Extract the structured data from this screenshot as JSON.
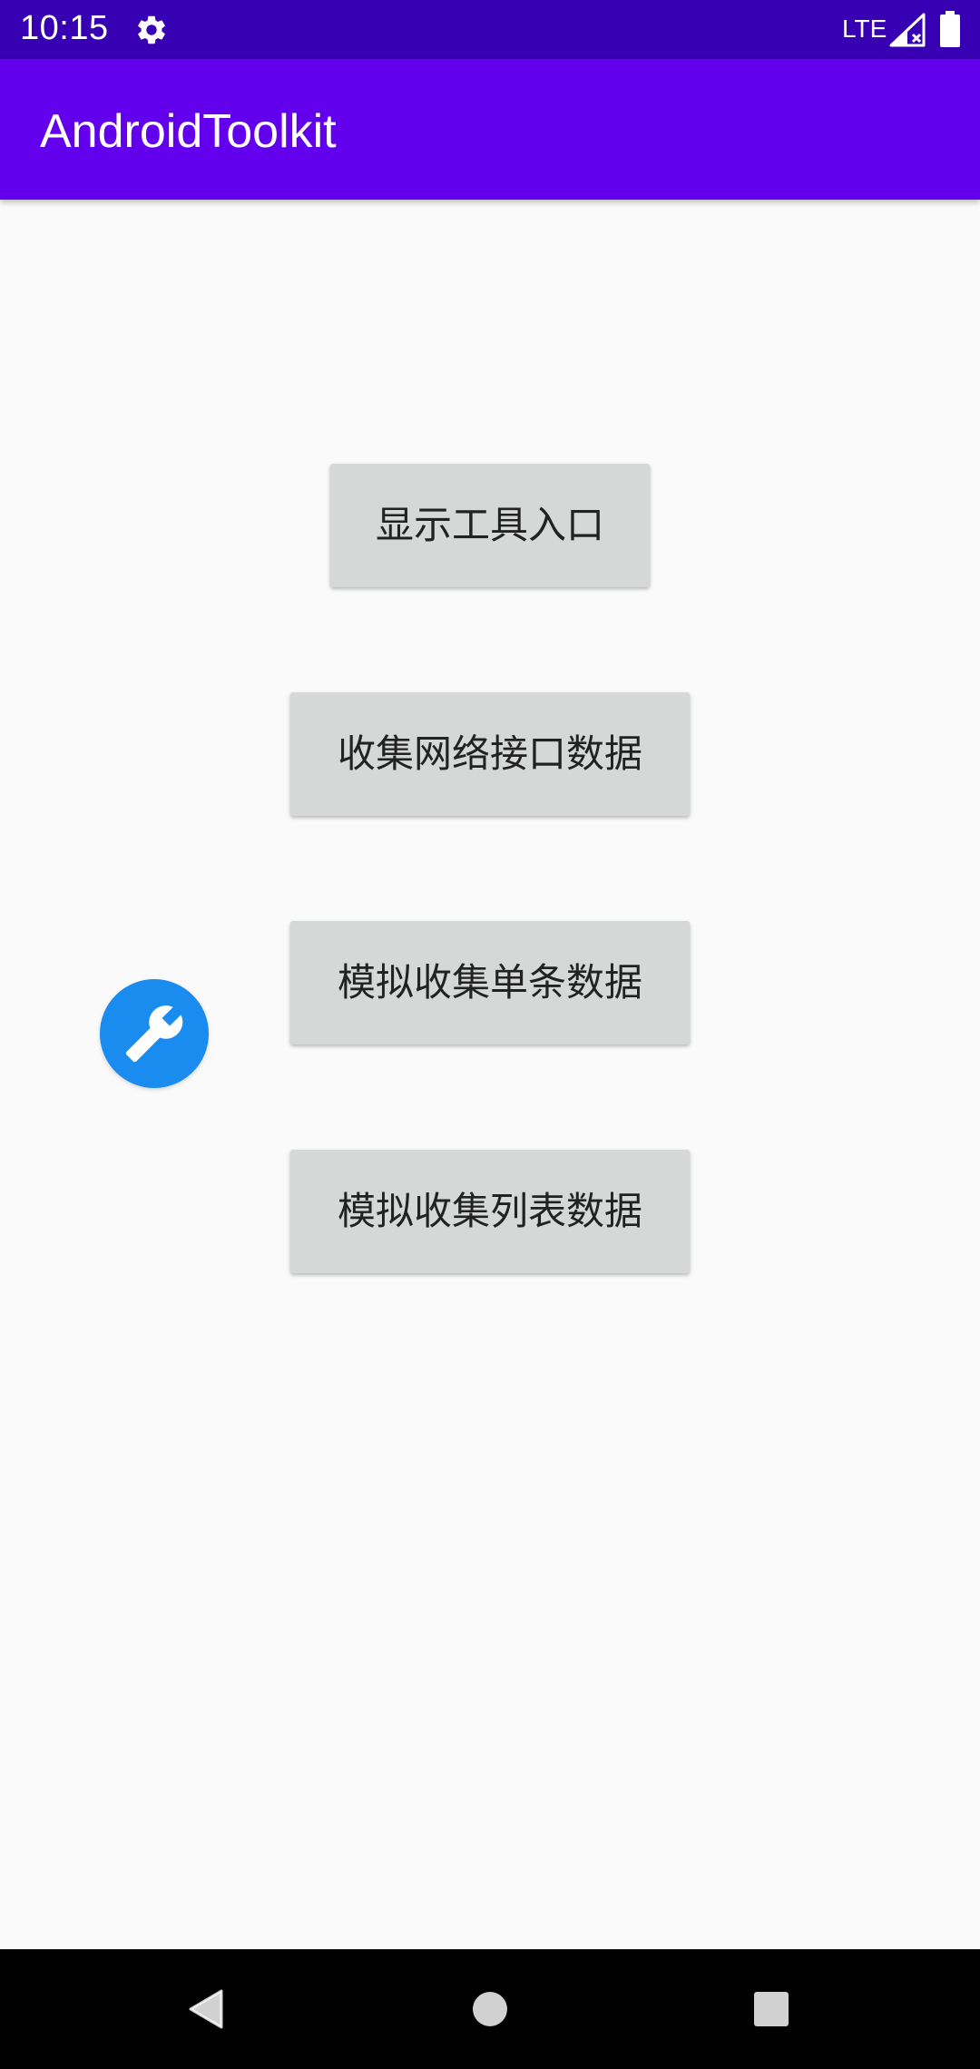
{
  "status_bar": {
    "time": "10:15",
    "network": "LTE",
    "icons": [
      "gear-icon",
      "signal-icon",
      "battery-icon"
    ]
  },
  "app_bar": {
    "title": "AndroidToolkit"
  },
  "buttons": [
    {
      "label": "显示工具入口"
    },
    {
      "label": "收集网络接口数据"
    },
    {
      "label": "模拟收集单条数据"
    },
    {
      "label": "模拟收集列表数据"
    }
  ],
  "floating_button": {
    "icon": "wrench-icon"
  },
  "nav_bar": {
    "icons": [
      "back-icon",
      "home-icon",
      "recents-icon"
    ]
  },
  "colors": {
    "status_bar": "#3700b3",
    "app_bar": "#6200ee",
    "background": "#fafafa",
    "button": "#d6d7d7",
    "fab": "#1a8cf0",
    "nav_bar": "#000000"
  }
}
